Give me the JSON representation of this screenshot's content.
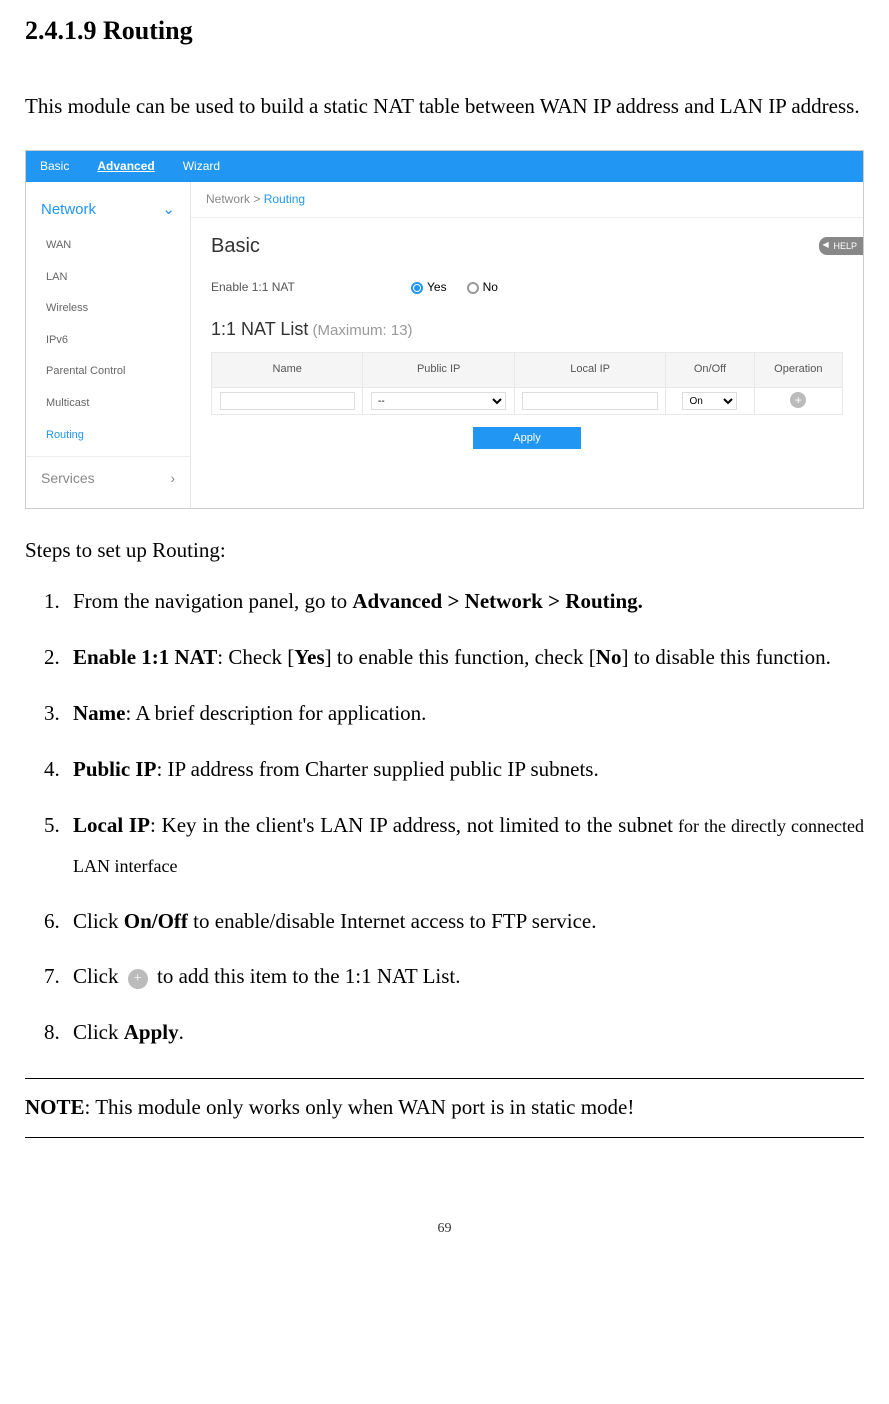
{
  "heading": "2.4.1.9 Routing",
  "intro": "This module can be used to build a static NAT table between WAN IP address and LAN IP address.",
  "ui": {
    "tabs": {
      "basic": "Basic",
      "advanced": "Advanced",
      "wizard": "Wizard"
    },
    "sidebar": {
      "network": "Network",
      "items": [
        "WAN",
        "LAN",
        "Wireless",
        "IPv6",
        "Parental Control",
        "Multicast",
        "Routing"
      ],
      "services": "Services"
    },
    "breadcrumb": {
      "network": "Network",
      "sep": " > ",
      "routing": "Routing"
    },
    "section_basic": "Basic",
    "enable_label": "Enable 1:1 NAT",
    "radio_yes": "Yes",
    "radio_no": "No",
    "nat_list_title": "1:1 NAT List",
    "nat_list_hint": " (Maximum: 13)",
    "table": {
      "headers": [
        "Name",
        "Public IP",
        "Local IP",
        "On/Off",
        "Operation"
      ],
      "row": {
        "public_ip_placeholder": "--",
        "onoff": "On"
      }
    },
    "apply": "Apply",
    "help": "HELP"
  },
  "steps_intro": "Steps to set up Routing:",
  "steps": {
    "s1_a": "From the navigation panel, go to ",
    "s1_b": "Advanced > Network > Routing.",
    "s2_a": "Enable 1:1 NAT",
    "s2_b": ": Check [",
    "s2_c": "Yes",
    "s2_d": "] to enable this function, check [",
    "s2_e": "No",
    "s2_f": "] to disable this function.",
    "s3_a": "Name",
    "s3_b": ": A brief description for application.",
    "s4_a": "Public IP",
    "s4_b": ": IP address from Charter supplied public IP subnets.",
    "s5_a": "Local IP",
    "s5_b": ": Key in the client's LAN IP address, not limited to the subnet",
    "s5_c": " for the directly connected LAN interface",
    "s6_a": "Click ",
    "s6_b": "On/Off",
    "s6_c": " to enable/disable Internet access to FTP service.",
    "s7_a": "Click ",
    "s7_b": " to add this item to the 1:1 NAT List.",
    "s8_a": "Click ",
    "s8_b": "Apply",
    "s8_c": "."
  },
  "note_label": "NOTE",
  "note_text": ": This module only works only when WAN port is in static mode!",
  "page_number": "69"
}
